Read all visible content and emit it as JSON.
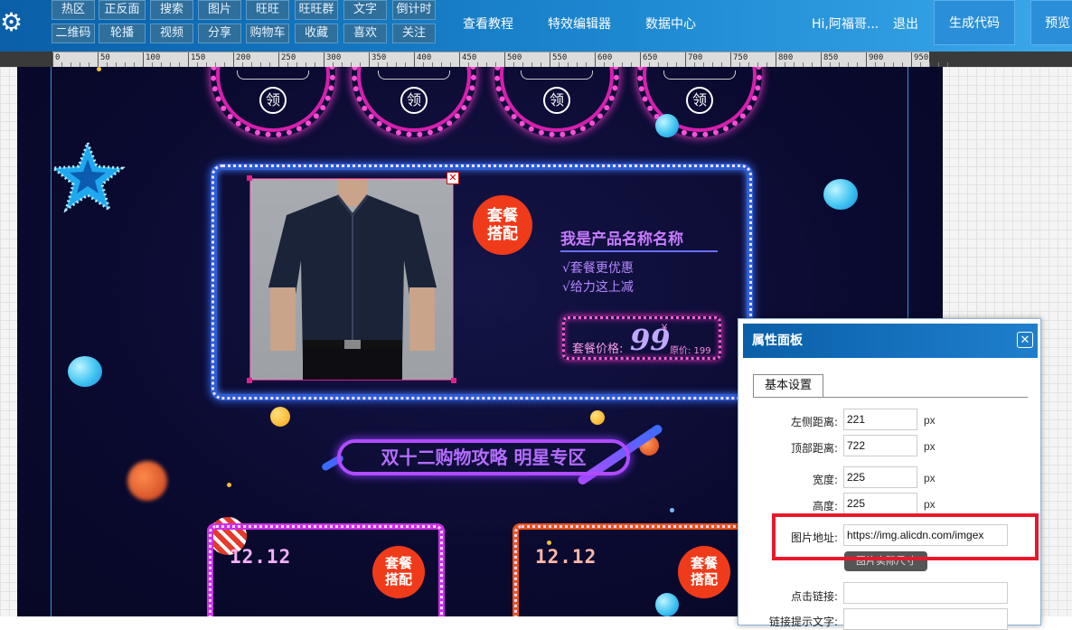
{
  "toolbar": {
    "row1": [
      "热区",
      "正反面",
      "搜索",
      "图片",
      "旺旺",
      "旺旺群",
      "文字",
      "倒计时"
    ],
    "row2": [
      "二维码",
      "轮播",
      "视频",
      "分享",
      "购物车",
      "收藏",
      "喜欢",
      "关注"
    ],
    "settings_icon": "gear-icon"
  },
  "nav": {
    "tutorial": "查看教程",
    "effects_editor": "特效编辑器",
    "data_center": "数据中心",
    "greeting": "Hi,阿福哥...",
    "logout": "退出",
    "generate_code": "生成代码",
    "preview": "预览"
  },
  "ruler": {
    "labels": [
      "0",
      "50",
      "100",
      "150",
      "200",
      "250",
      "300",
      "350",
      "400",
      "450",
      "500",
      "550",
      "600",
      "650",
      "700",
      "750",
      "800",
      "850",
      "900",
      "950"
    ]
  },
  "canvas": {
    "coupons": [
      {
        "label": "领"
      },
      {
        "label": "领"
      },
      {
        "label": "领"
      },
      {
        "label": "领"
      }
    ],
    "product": {
      "badge_line1": "套餐",
      "badge_line2": "搭配",
      "name": "我是产品名称名称",
      "bullet1": "√套餐更优惠",
      "bullet2": "√给力这上减",
      "price_label": "套餐价格:",
      "price_value": "99",
      "price_symbol": "¥",
      "original_price": "原价: 199",
      "close_mark": "✕"
    },
    "banner": "双十二购物攻略  明星专区",
    "cards": [
      {
        "date": "12.12",
        "badge_line1": "套餐",
        "badge_line2": "搭配"
      },
      {
        "date": "12.12",
        "badge_line1": "套餐",
        "badge_line2": "搭配"
      }
    ]
  },
  "panel": {
    "title": "属性面板",
    "close": "✕",
    "tab": "基本设置",
    "fields": {
      "left_label": "左侧距离:",
      "left_value": "221",
      "left_unit": "px",
      "top_label": "顶部距离:",
      "top_value": "722",
      "top_unit": "px",
      "width_label": "宽度:",
      "width_value": "225",
      "width_unit": "px",
      "height_label": "高度:",
      "height_value": "225",
      "height_unit": "px",
      "url_label": "图片地址:",
      "url_value": "https://img.alicdn.com/imgex",
      "tooltip": "图片实际尺寸",
      "link_label": "点击链接:",
      "link_value": "",
      "linktip_label": "链接提示文字:"
    }
  },
  "colors": {
    "toolbar_bg": "#0a5fa8",
    "canvas_bg": "#0a0a30",
    "highlight": "#e8182a",
    "badge_red": "#f03b1a"
  }
}
